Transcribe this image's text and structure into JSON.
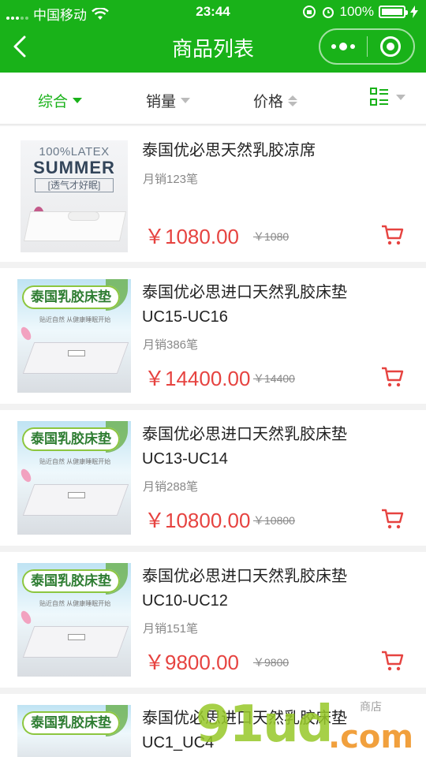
{
  "status_bar": {
    "carrier": "中国移动",
    "time": "23:44",
    "battery": "100%"
  },
  "header": {
    "title": "商品列表"
  },
  "sort_bar": {
    "items": [
      {
        "label": "综合",
        "active": true
      },
      {
        "label": "销量",
        "active": false
      },
      {
        "label": "价格",
        "active": false
      }
    ]
  },
  "products": [
    {
      "name": "泰国优必思天然乳胶凉席",
      "sales": "月销123笔",
      "price": "￥1080.00",
      "original_price": "￥1080",
      "image": {
        "line1": "100%LATEX",
        "line2": "SUMMER",
        "line3": "[透气才好眠]"
      }
    },
    {
      "name": "泰国优必思进口天然乳胶床垫UC15-UC16",
      "sales": "月销386笔",
      "price": "￥14400.00",
      "original_price": "￥14400",
      "image": {
        "banner": "泰国乳胶床垫",
        "sub": "贴近自然 从健康睡眠开始"
      }
    },
    {
      "name": "泰国优必思进口天然乳胶床垫UC13-UC14",
      "sales": "月销288笔",
      "price": "￥10800.00",
      "original_price": "￥10800",
      "image": {
        "banner": "泰国乳胶床垫",
        "sub": "贴近自然 从健康睡眠开始"
      }
    },
    {
      "name": "泰国优必思进口天然乳胶床垫UC10-UC12",
      "sales": "月销151笔",
      "price": "￥9800.00",
      "original_price": "￥9800",
      "image": {
        "banner": "泰国乳胶床垫",
        "sub": "贴近自然 从健康睡眠开始"
      }
    },
    {
      "name": "泰国优必思进口天然乳胶床垫UC1_UC4",
      "image": {
        "banner": "泰国乳胶床垫"
      }
    }
  ],
  "watermark": {
    "main": "91ud",
    "suffix": ".com",
    "small": "商店"
  },
  "colors": {
    "brand_green": "#19b219",
    "price_red": "#e64340"
  }
}
